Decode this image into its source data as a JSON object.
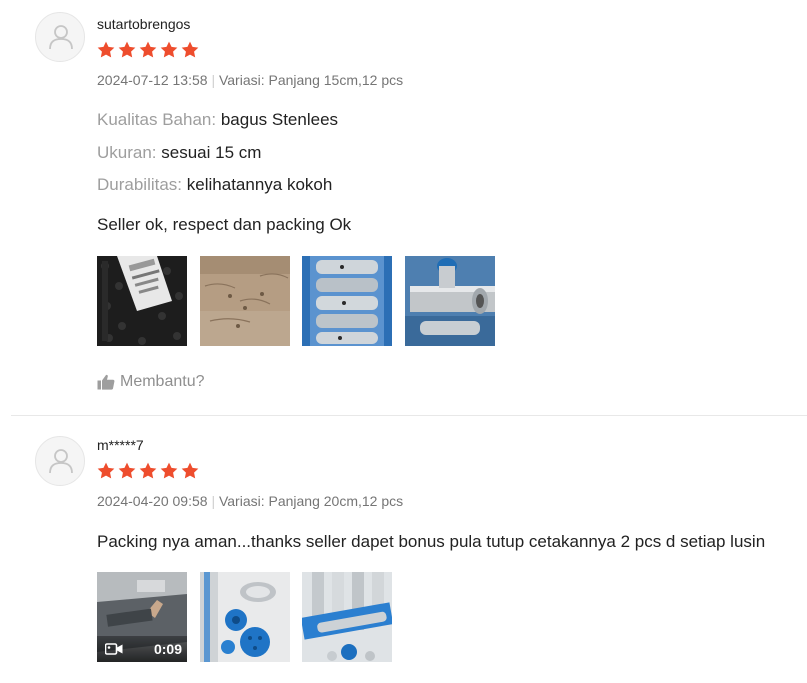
{
  "colors": {
    "star": "#ee4d2d",
    "muted": "#757575",
    "label": "#9e9e9e"
  },
  "reviews": [
    {
      "username": "sutartobrengos",
      "rating": 5,
      "date": "2024-07-12 13:58",
      "separator": "|",
      "variation": "Variasi: Panjang 15cm,12 pcs",
      "attributes": [
        {
          "key": "Kualitas Bahan:",
          "value": "bagus Stenlees"
        },
        {
          "key": "Ukuran:",
          "value": "sesuai 15 cm"
        },
        {
          "key": "Durabilitas:",
          "value": "kelihatannya kokoh"
        }
      ],
      "comment": "Seller ok, respect dan packing Ok",
      "helpful_label": "Membantu?"
    },
    {
      "username": "m*****7",
      "rating": 5,
      "date": "2024-04-20 09:58",
      "separator": "|",
      "variation": "Variasi: Panjang 20cm,12 pcs",
      "comment": "Packing nya aman...thanks seller dapet bonus pula tutup cetakannya 2 pcs d setiap lusin",
      "video_duration": "0:09"
    }
  ],
  "icons": {
    "avatar": "user-placeholder-icon",
    "star": "star-icon",
    "helpful": "thumbs-up-icon",
    "video": "video-camera-icon"
  }
}
